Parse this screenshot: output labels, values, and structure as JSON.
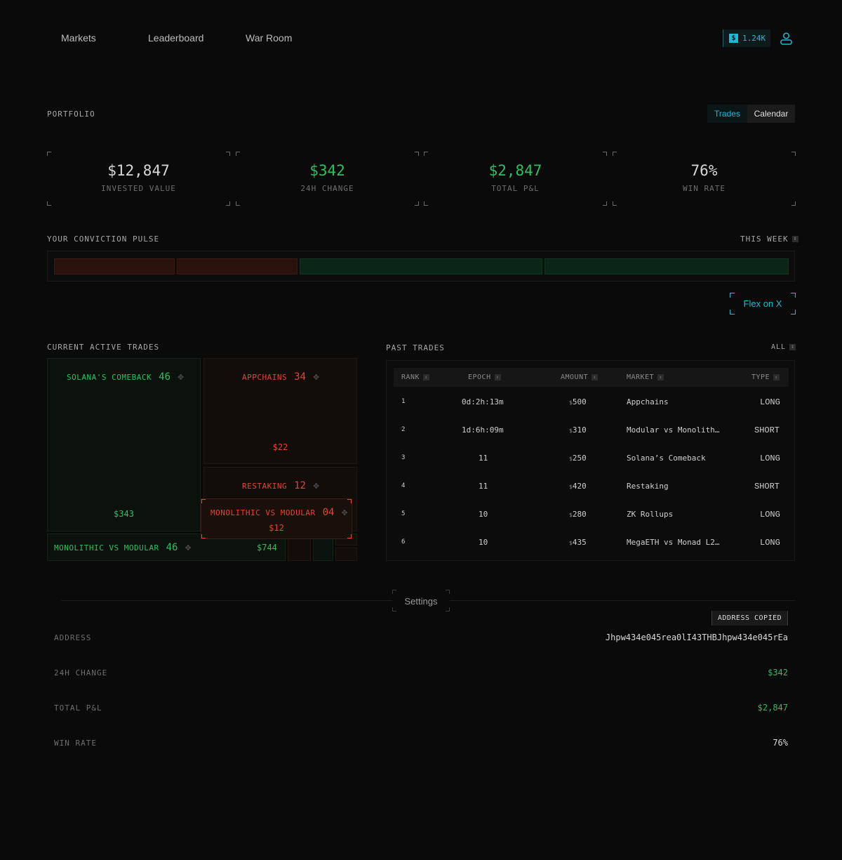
{
  "nav": {
    "markets": "Markets",
    "leaderboard": "Leaderboard",
    "war_room": "War Room"
  },
  "balance": {
    "symbol": "$",
    "amount": "1.24K"
  },
  "portfolio": {
    "title": "PORTFOLIO",
    "tabs": {
      "trades": "Trades",
      "calendar": "Calendar"
    },
    "stats": [
      {
        "value": "$12,847",
        "label": "INVESTED VALUE"
      },
      {
        "value": "$342",
        "label": "24H CHANGE"
      },
      {
        "value": "$2,847",
        "label": "TOTAL P&L"
      },
      {
        "value": "76%",
        "label": "WIN RATE"
      }
    ]
  },
  "pulse": {
    "title": "YOUR CONVICTION PULSE",
    "period": "THIS WEEK"
  },
  "flex_button": "Flex on X",
  "active_trades": {
    "title": "CURRENT ACTIVE TRADES",
    "tiles": [
      {
        "name": "SOLANA'S COMEBACK",
        "count": "46",
        "value": "$343",
        "side": "green"
      },
      {
        "name": "APPCHAINS",
        "count": "34",
        "value": "$22",
        "side": "red"
      },
      {
        "name": "RESTAKING",
        "count": "12",
        "value": "",
        "side": "red"
      },
      {
        "name": "MONOLITHIC VS MODULAR",
        "count": "04",
        "value": "$12",
        "side": "red"
      },
      {
        "name": "MONOLITHIC VS MODULAR",
        "count": "46",
        "value": "$744",
        "side": "green"
      }
    ]
  },
  "past_trades": {
    "title": "PAST TRADES",
    "filter": "ALL",
    "columns": [
      "RANK",
      "EPOCH",
      "AMOUNT",
      "MARKET",
      "TYPE"
    ],
    "rows": [
      {
        "rank": "1",
        "epoch": "0d:2h:13m",
        "amount": "500",
        "market": "Appchains",
        "type": "LONG"
      },
      {
        "rank": "2",
        "epoch": "1d:6h:09m",
        "amount": "310",
        "market": "Modular vs Monolith…",
        "type": "SHORT"
      },
      {
        "rank": "3",
        "epoch": "11",
        "amount": "250",
        "market": "Solana’s Comeback",
        "type": "LONG"
      },
      {
        "rank": "4",
        "epoch": "11",
        "amount": "420",
        "market": "Restaking",
        "type": "SHORT"
      },
      {
        "rank": "5",
        "epoch": "10",
        "amount": "280",
        "market": "ZK Rollups",
        "type": "LONG"
      },
      {
        "rank": "6",
        "epoch": "10",
        "amount": "435",
        "market": "MegaETH vs Monad L2…",
        "type": "LONG"
      }
    ]
  },
  "settings": {
    "title": "Settings",
    "toast": "ADDRESS COPIED",
    "rows": [
      {
        "label": "ADDRESS",
        "value": "Jhpw434e045rea0lI43THBJhpw434e045rEa"
      },
      {
        "label": "24H CHANGE",
        "value": "$342"
      },
      {
        "label": "TOTAL P&L",
        "value": "$2,847"
      },
      {
        "label": "WIN RATE",
        "value": "76%"
      }
    ]
  },
  "colors": {
    "long": "#e0462f",
    "short": "#2fbf62",
    "accent": "#22b8d4"
  }
}
